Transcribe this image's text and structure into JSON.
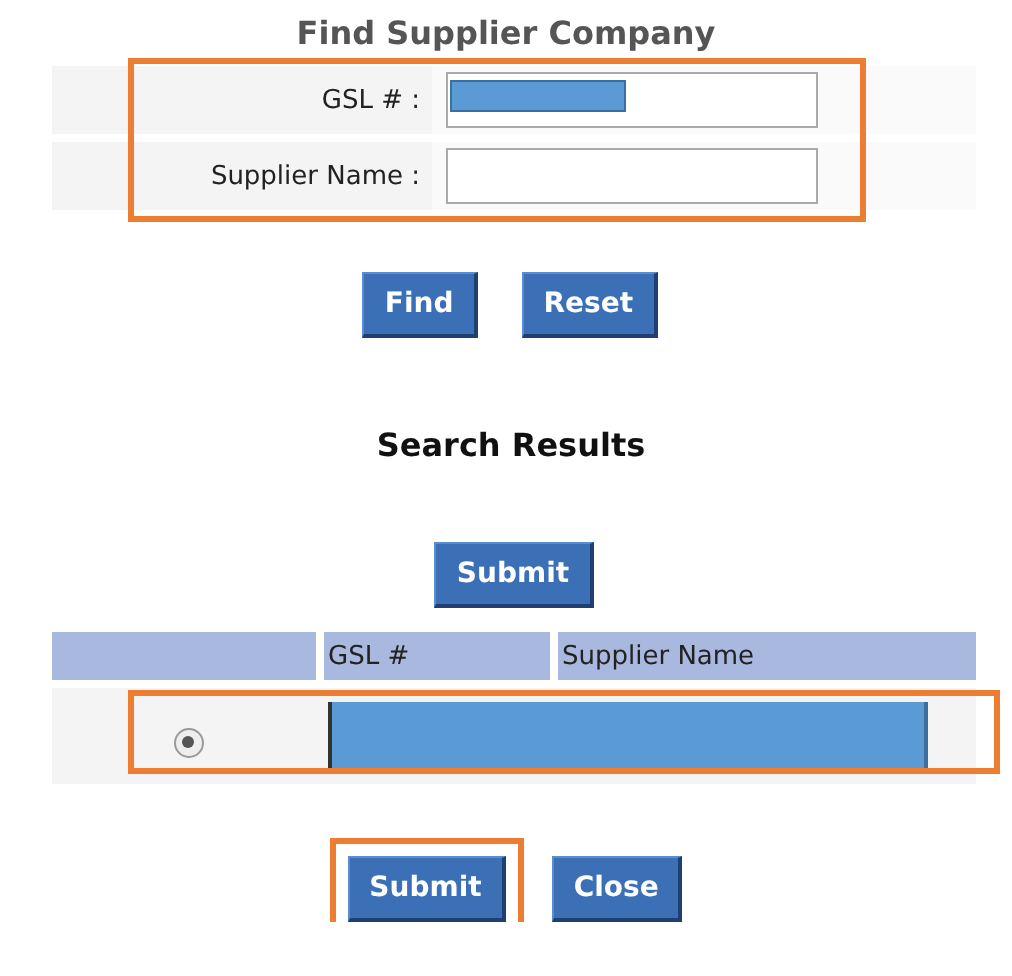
{
  "title": "Find Supplier Company",
  "search_form": {
    "highlighted": true,
    "fields": [
      {
        "label": "GSL # :",
        "redacted": true
      },
      {
        "label": "Supplier Name :",
        "redacted": false
      }
    ]
  },
  "form_buttons": [
    {
      "label": "Find",
      "highlighted": false
    },
    {
      "label": "Reset",
      "highlighted": false
    }
  ],
  "results_heading": "Search Results",
  "top_button": {
    "label": "Submit",
    "highlighted": false
  },
  "table": {
    "columns": [
      "GSL #",
      "Supplier Name"
    ],
    "rows": [
      {
        "selected": true,
        "redacted": true,
        "highlighted": true
      }
    ]
  },
  "bottom_buttons": [
    {
      "label": "Submit",
      "highlighted": true
    },
    {
      "label": "Close",
      "highlighted": false
    }
  ]
}
